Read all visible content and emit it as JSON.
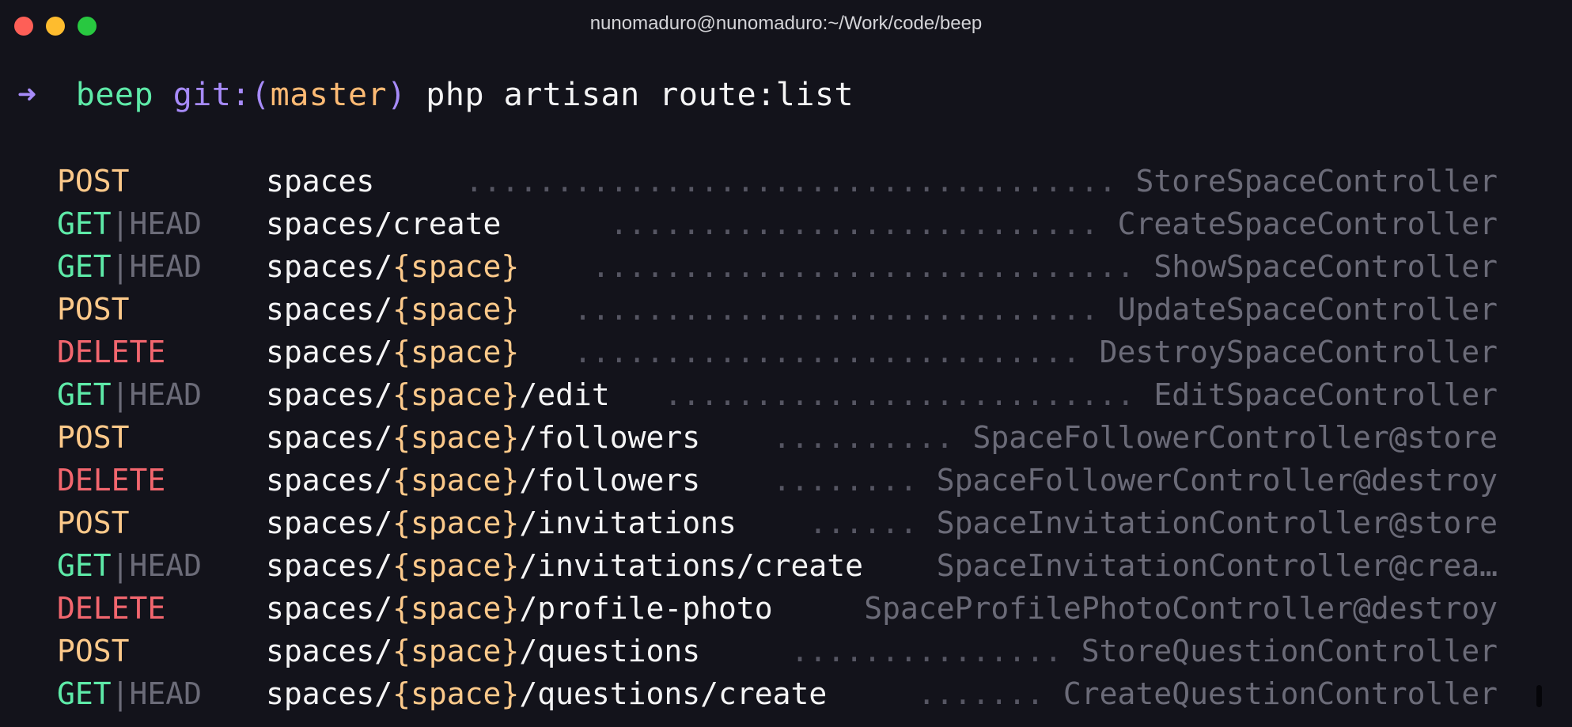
{
  "window": {
    "title": "nunomaduro@nunomaduro:~/Work/code/beep"
  },
  "prompt": {
    "arrow": "➜",
    "dir": "beep",
    "git": "git:(",
    "branch": "master",
    "git_close": ")",
    "command": "php artisan route:list"
  },
  "routes": [
    {
      "method": "POST",
      "head": "",
      "uri": "spaces",
      "param": "",
      "suffix": "",
      "dots": "....................................",
      "action": "StoreSpaceController"
    },
    {
      "method": "GET",
      "head": "|HEAD",
      "uri": "spaces/create",
      "param": "",
      "suffix": "",
      "dots": "...........................",
      "action": "CreateSpaceController"
    },
    {
      "method": "GET",
      "head": "|HEAD",
      "uri": "spaces/",
      "param": "{space}",
      "suffix": "",
      "dots": "..............................",
      "action": "ShowSpaceController"
    },
    {
      "method": "POST",
      "head": "",
      "uri": "spaces/",
      "param": "{space}",
      "suffix": "",
      "dots": ".............................",
      "action": "UpdateSpaceController"
    },
    {
      "method": "DELETE",
      "head": "",
      "uri": "spaces/",
      "param": "{space}",
      "suffix": "",
      "dots": "............................",
      "action": "DestroySpaceController"
    },
    {
      "method": "GET",
      "head": "|HEAD",
      "uri": "spaces/",
      "param": "{space}",
      "suffix": "/edit",
      "dots": "..........................",
      "action": "EditSpaceController"
    },
    {
      "method": "POST",
      "head": "",
      "uri": "spaces/",
      "param": "{space}",
      "suffix": "/followers",
      "dots": "..........",
      "action": "SpaceFollowerController@store"
    },
    {
      "method": "DELETE",
      "head": "",
      "uri": "spaces/",
      "param": "{space}",
      "suffix": "/followers",
      "dots": "........",
      "action": "SpaceFollowerController@destroy"
    },
    {
      "method": "POST",
      "head": "",
      "uri": "spaces/",
      "param": "{space}",
      "suffix": "/invitations",
      "dots": "......",
      "action": "SpaceInvitationController@store"
    },
    {
      "method": "GET",
      "head": "|HEAD",
      "uri": "spaces/",
      "param": "{space}",
      "suffix": "/invitations/create",
      "dots": "",
      "action": "SpaceInvitationController@crea…"
    },
    {
      "method": "DELETE",
      "head": "",
      "uri": "spaces/",
      "param": "{space}",
      "suffix": "/profile-photo",
      "dots": "",
      "action": "SpaceProfilePhotoController@destroy"
    },
    {
      "method": "POST",
      "head": "",
      "uri": "spaces/",
      "param": "{space}",
      "suffix": "/questions",
      "dots": "...............",
      "action": "StoreQuestionController"
    },
    {
      "method": "GET",
      "head": "|HEAD",
      "uri": "spaces/",
      "param": "{space}",
      "suffix": "/questions/create",
      "dots": ".......",
      "action": "CreateQuestionController"
    }
  ]
}
